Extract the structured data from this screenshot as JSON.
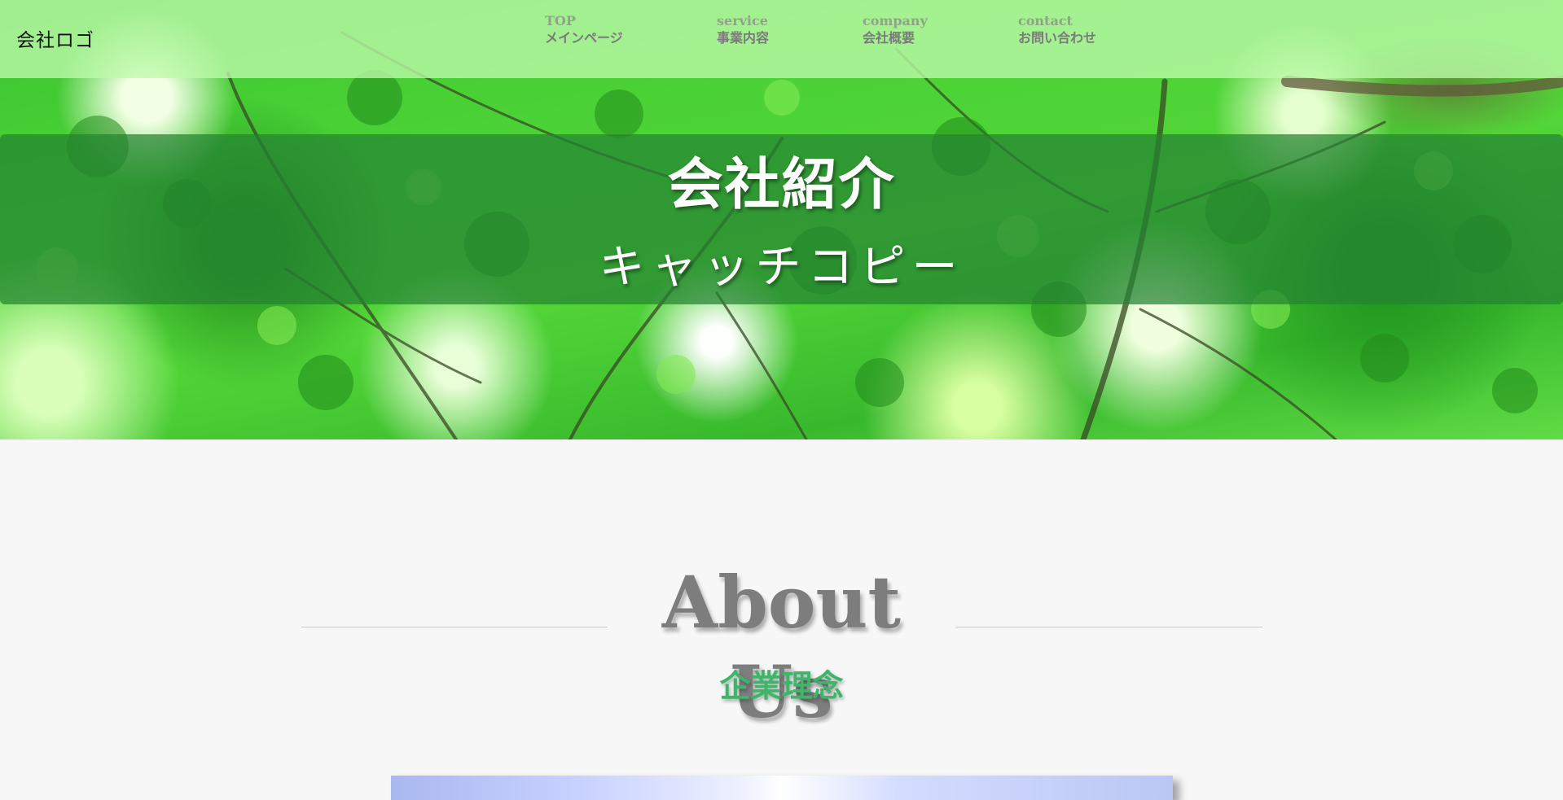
{
  "header": {
    "logo": "会社ロゴ",
    "nav": [
      {
        "en": "TOP",
        "ja": "メインページ"
      },
      {
        "en": "service",
        "ja": "事業内容"
      },
      {
        "en": "company",
        "ja": "会社概要"
      },
      {
        "en": "contact",
        "ja": "お問い合わせ"
      }
    ]
  },
  "hero": {
    "title": "会社紹介",
    "catch_copy": "キャッチコピー"
  },
  "about": {
    "heading": "About Us",
    "subheading": "企業理念"
  },
  "colors": {
    "header_bg": "#bffaaa",
    "title_band": "#248232",
    "nav_en": "#8fa487",
    "nav_ja": "#7a7a7a",
    "about_heading": "#7d7d7d",
    "about_subheading": "#3fb56a",
    "page_bg": "#f7f7f7"
  }
}
